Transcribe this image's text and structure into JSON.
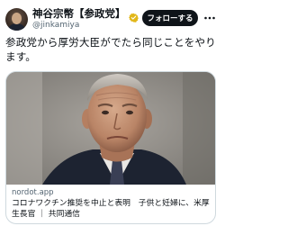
{
  "author": {
    "display_name": "神谷宗幣【参政党】",
    "handle": "@jinkamiya",
    "avatar_icon": "avatar"
  },
  "follow_button": {
    "label": "フォローする"
  },
  "more_button": {
    "icon": "more-horizontal-icon"
  },
  "tweet": {
    "text": "参政党から厚労大臣がでたら同じことをやります。"
  },
  "link_card": {
    "domain": "nordot.app",
    "title": "コロナワクチン推奨を中止と表明　子供と妊婦に、米厚生長官 ｜ 共同通信"
  },
  "colors": {
    "text_primary": "#0f1419",
    "text_secondary": "#536471",
    "follow_bg": "#0f1419",
    "verified_badge": "#e2b719",
    "card_border": "#cfd9de"
  }
}
